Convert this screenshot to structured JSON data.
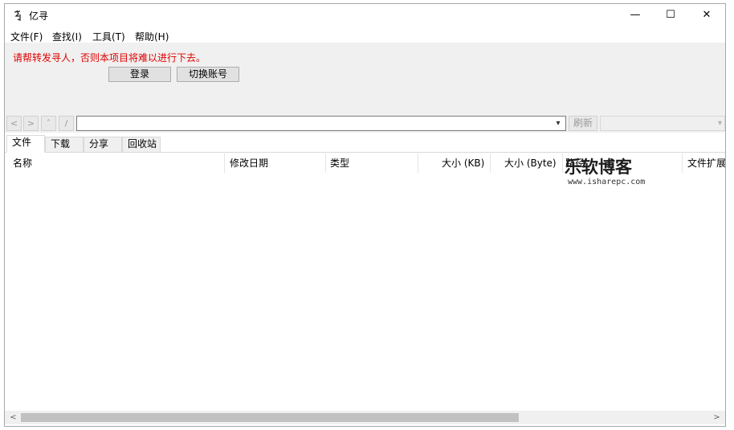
{
  "window": {
    "title": "亿寻",
    "icon": "yixun-logo-icon",
    "minimize": "—",
    "maximize": "☐",
    "close": "✕"
  },
  "menu": [
    {
      "label": "文件(F)"
    },
    {
      "label": "查找(I)"
    },
    {
      "label": "工具(T)"
    },
    {
      "label": "帮助(H)"
    }
  ],
  "notice": {
    "text": "请帮转发寻人，否则本项目将难以进行下去。",
    "color": "#e00000"
  },
  "buttons": {
    "login": "登录",
    "switch_account": "切换账号"
  },
  "nav": {
    "back": "<",
    "forward": ">",
    "up": "ˆ",
    "root": "/",
    "path_value": "",
    "refresh": "刷新"
  },
  "tabs": [
    {
      "label": "文件",
      "active": true
    },
    {
      "label": "下载",
      "active": false
    },
    {
      "label": "分享",
      "active": false
    },
    {
      "label": "回收站",
      "active": false
    }
  ],
  "columns": [
    {
      "label": "名称"
    },
    {
      "label": "修改日期"
    },
    {
      "label": "类型"
    },
    {
      "label": "大小 (KB)"
    },
    {
      "label": "大小 (Byte)"
    },
    {
      "label": "路径"
    },
    {
      "label": "文件扩展"
    }
  ],
  "watermark": {
    "title": "乐软博客",
    "url": "www.isharepc.com"
  },
  "scrollbar": {
    "left": "<",
    "right": ">"
  }
}
